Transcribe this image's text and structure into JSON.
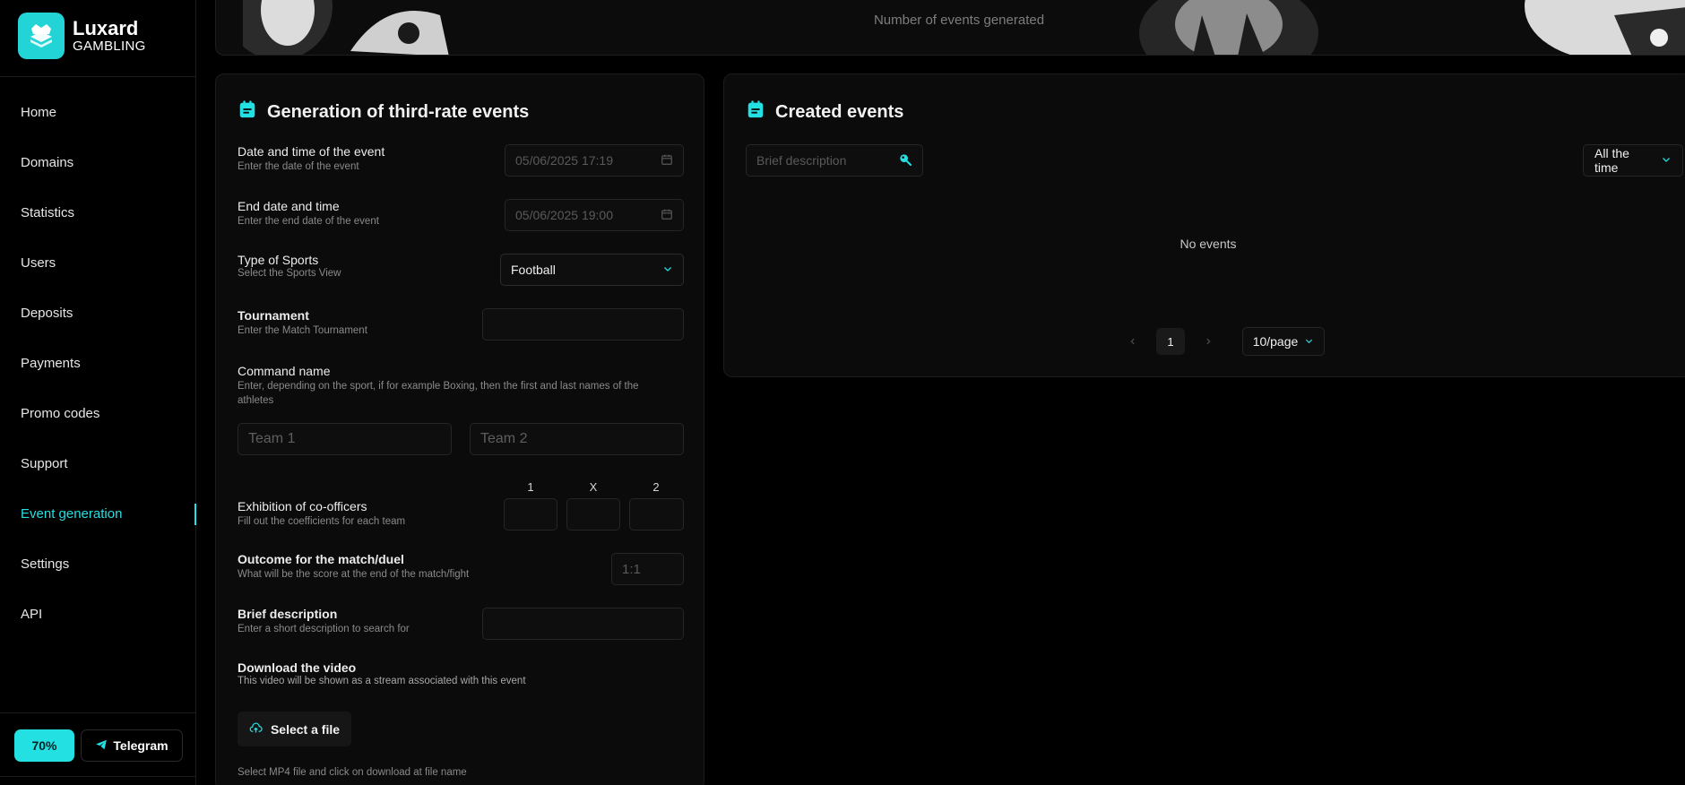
{
  "brand": {
    "name": "Luxard",
    "sub": "GAMBLING"
  },
  "sidebar": {
    "items": [
      {
        "label": "Home"
      },
      {
        "label": "Domains"
      },
      {
        "label": "Statistics"
      },
      {
        "label": "Users"
      },
      {
        "label": "Deposits"
      },
      {
        "label": "Payments"
      },
      {
        "label": "Promo codes"
      },
      {
        "label": "Support"
      },
      {
        "label": "Event generation",
        "active": true
      },
      {
        "label": "Settings"
      },
      {
        "label": "API"
      }
    ],
    "percent_label": "70%",
    "telegram_label": "Telegram"
  },
  "banner": {
    "caption": "Number of events generated"
  },
  "generator": {
    "title": "Generation of third-rate events",
    "date_start": {
      "label": "Date and time of the event",
      "hint": "Enter the date of the event",
      "placeholder": "05/06/2025 17:19"
    },
    "date_end": {
      "label": "End date and time",
      "hint": "Enter the end date of the event",
      "placeholder": "05/06/2025 19:00"
    },
    "sport": {
      "label": "Type of Sports",
      "hint": "Select the Sports View",
      "value": "Football"
    },
    "tournament": {
      "label": "Tournament",
      "hint": "Enter the Match Tournament",
      "value": ""
    },
    "command": {
      "label": "Command name",
      "hint": "Enter, depending on the sport, if for example Boxing, then the first and last names of the athletes",
      "team1_placeholder": "Team 1",
      "team2_placeholder": "Team 2"
    },
    "odds": {
      "label": "Exhibition of co-officers",
      "hint": "Fill out the coefficients for each team",
      "headers": [
        "1",
        "X",
        "2"
      ]
    },
    "outcome": {
      "label": "Outcome for the match/duel",
      "hint": "What will be the score at the end of the match/fight",
      "placeholder": "1:1"
    },
    "brief": {
      "label": "Brief description",
      "hint": "Enter a short description to search for",
      "value": ""
    },
    "video": {
      "label": "Download the video",
      "hint": "This video will be shown as a stream associated with this event",
      "button": "Select a file",
      "file_hint": "Select MP4 file and click on download at file name"
    }
  },
  "created": {
    "title": "Created events",
    "search_placeholder": "Brief description",
    "period": "All the time",
    "empty": "No events",
    "page": "1",
    "page_size": "10/page"
  },
  "colors": {
    "accent": "#23e0e3",
    "background": "#000000",
    "card": "#0b0b0b"
  },
  "icons": [
    "calendar-icon",
    "search-icon",
    "chevron-down-icon",
    "upload-icon",
    "telegram-icon",
    "logo-icon"
  ]
}
